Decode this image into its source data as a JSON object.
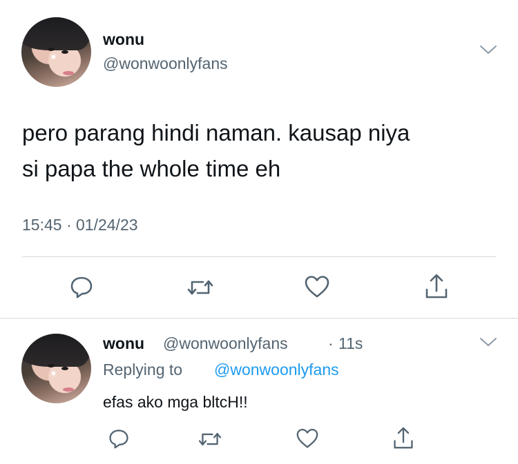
{
  "tweet": {
    "author_name": "wonu",
    "author_handle": "@wonwoonlyfans",
    "text_line1": "pero parang hindi naman. kausap niya",
    "text_line2": "si papa the whole time eh",
    "timestamp": "15:45 · 01/24/23"
  },
  "reply": {
    "author_name": "wonu",
    "author_handle": "@wonwoonlyfans",
    "separator": "·",
    "age": "11s",
    "replying_prefix": "Replying to",
    "replying_handle": "@wonwoonlyfans",
    "text": "efas ako mga bltcH!!"
  },
  "icons": {
    "reply": "reply-icon",
    "retweet": "retweet-icon",
    "like": "heart-icon",
    "share": "share-icon",
    "more": "chevron-down-icon"
  },
  "colors": {
    "text": "#0f1419",
    "secondary": "#536471",
    "link": "#1d9bf0",
    "divider": "#d4d9dd"
  }
}
